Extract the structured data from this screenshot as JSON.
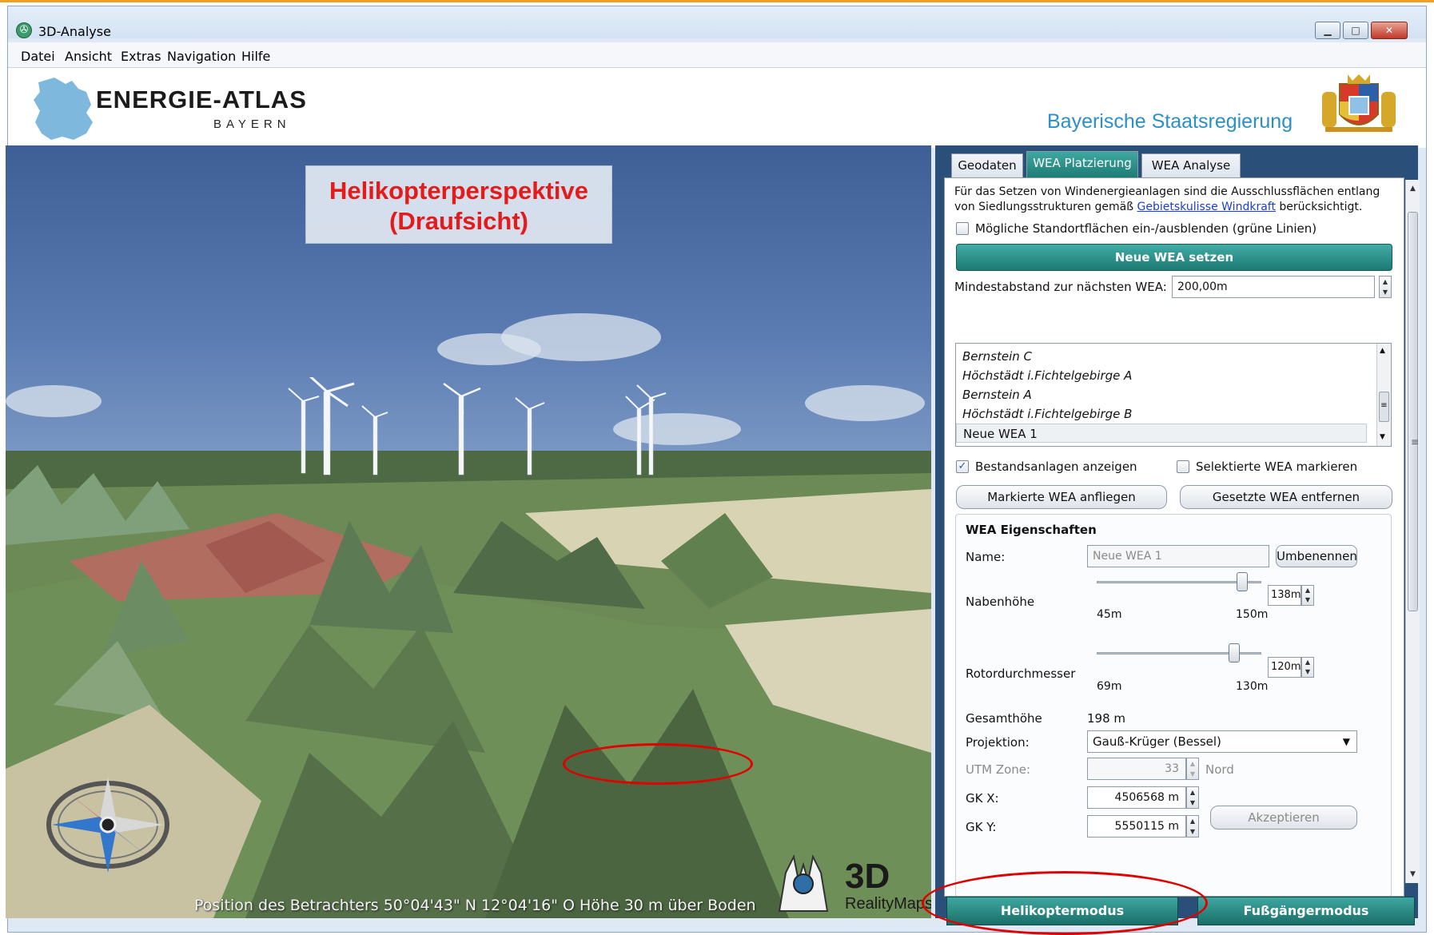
{
  "window": {
    "title": "3D-Analyse"
  },
  "menu": [
    "Datei",
    "Ansicht",
    "Extras",
    "Navigation",
    "Hilfe"
  ],
  "header": {
    "logo_main": "ENERGIE-ATLAS",
    "logo_sub": "BAYERN",
    "government": "Bayerische Staatsregierung"
  },
  "viewport": {
    "annotation_line1": "Helikopterperspektive",
    "annotation_line2": "(Draufsicht)",
    "status": "Position des Betrachters 50°04'43\" N 12°04'16\" O Höhe 30 m über Boden",
    "brand_3d": "3D",
    "brand_name": "RealityMaps"
  },
  "tabs": [
    {
      "label": "Geodaten",
      "active": false
    },
    {
      "label": "WEA Platzierung",
      "active": true
    },
    {
      "label": "WEA Analyse",
      "active": false
    }
  ],
  "panel": {
    "intro_line1": "Für das Setzen von Windenergieanlagen sind die Ausschlussflächen entlang",
    "intro_line2_pre": "von Siedlungsstrukturen gemäß ",
    "intro_link": "Gebietskulisse Windkraft",
    "intro_line2_post": " berücksichtigt.",
    "toggle_areas": "Mögliche Standortflächen ein-/ausblenden (grüne Linien)",
    "new_wea_button": "Neue WEA setzen",
    "min_distance_label": "Mindestabstand zur nächsten WEA:",
    "min_distance_value": "200,00m",
    "wea_list": [
      "Bernstein C",
      "Höchstädt i.Fichtelgebirge A",
      "Bernstein A",
      "Höchstädt i.Fichtelgebirge B",
      "Neue WEA 1"
    ],
    "selected_index": 4,
    "show_existing": "Bestandsanlagen anzeigen",
    "show_existing_checked": true,
    "mark_selected": "Selektierte WEA markieren",
    "mark_selected_checked": false,
    "fly_to_button": "Markierte WEA anfliegen",
    "remove_button": "Gesetzte WEA entfernen",
    "properties": {
      "title": "WEA Eigenschaften",
      "name_label": "Name:",
      "name_value": "Neue WEA 1",
      "rename_button": "Umbenennen",
      "hub_label": "Nabenhöhe",
      "hub_min": "45m",
      "hub_max": "150m",
      "hub_value": "138m",
      "hub_fraction": 0.885,
      "rotor_label": "Rotordurchmesser",
      "rotor_min": "69m",
      "rotor_max": "130m",
      "rotor_value": "120m",
      "rotor_fraction": 0.836,
      "total_label": "Gesamthöhe",
      "total_value": "198 m",
      "projection_label": "Projektion:",
      "projection_value": "Gauß-Krüger (Bessel)",
      "utm_label": "UTM Zone:",
      "utm_value": "33",
      "utm_hemisphere": "Nord",
      "gkx_label": "GK X:",
      "gkx_value": "4506568 m",
      "gky_label": "GK Y:",
      "gky_value": "5550115 m",
      "accept_button": "Akzeptieren"
    }
  },
  "modes": {
    "helicopter": "Helikoptermodus",
    "pedestrian": "Fußgängermodus"
  },
  "colors": {
    "accent_teal": "#2a918a",
    "annotation_red": "#e31b1b",
    "government_blue": "#2c8fc7",
    "panel_background": "#2a4f78"
  }
}
